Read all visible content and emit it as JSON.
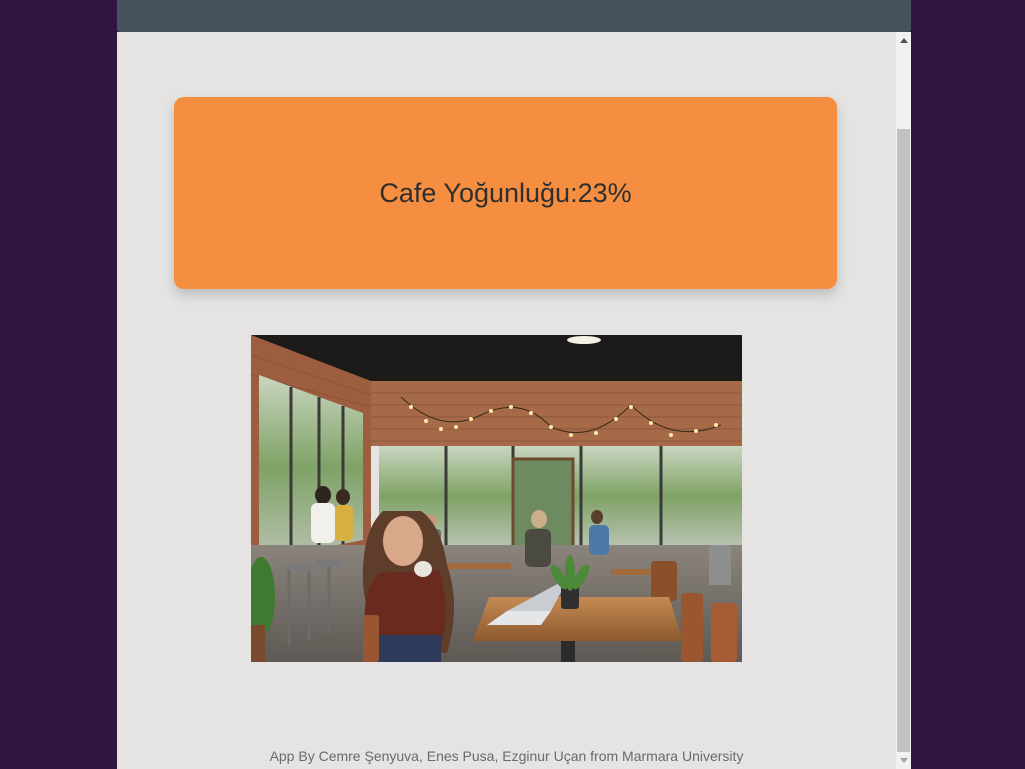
{
  "status_card": {
    "label": "Cafe Yoğunluğu:",
    "value": "23%"
  },
  "photo": {
    "icon": "cafe-interior-image"
  },
  "footer": {
    "credit": "App By Cemre Şenyuva, Enes Pusa, Ezginur Uçan from Marmara University"
  },
  "colors": {
    "page_background": "#2e1640",
    "titlebar": "#45525c",
    "viewport": "#e6e4e3",
    "card": "#f68e42"
  }
}
